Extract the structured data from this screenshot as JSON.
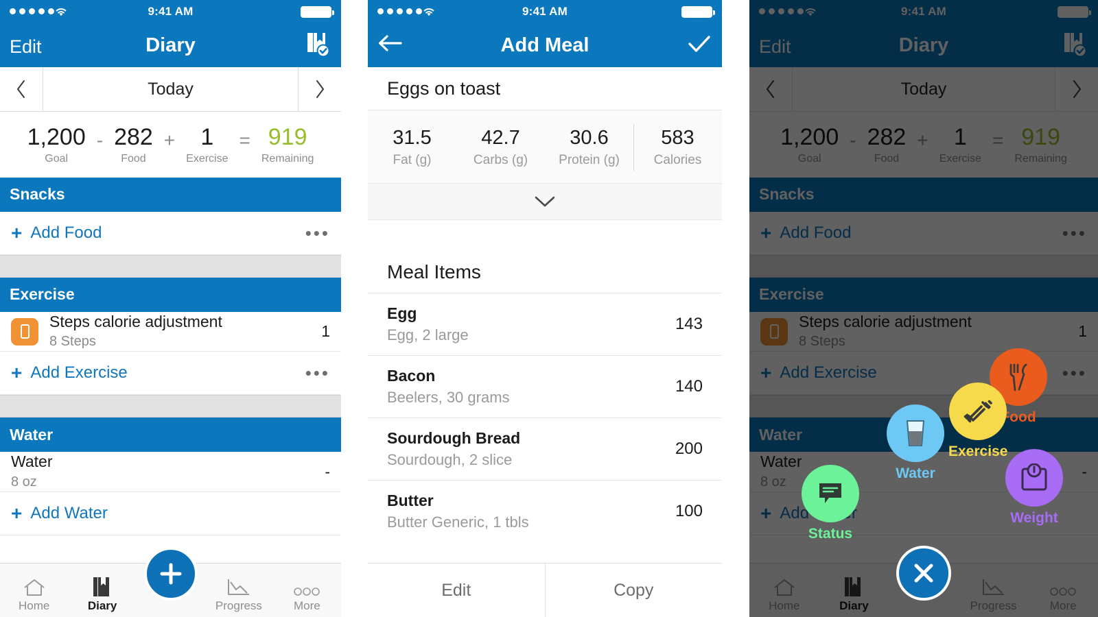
{
  "status_bar": {
    "time": "9:41 AM",
    "signal_dots": 5,
    "wifi_icon": "wifi-icon",
    "battery_icon": "battery-full-icon"
  },
  "colors": {
    "brand_blue": "#0b77bd",
    "accent_link": "#1177bd",
    "remaining_green": "#97bc2c",
    "steps_orange": "#f09234",
    "water_blue": "#6dc8f3",
    "food_orange": "#e95c1e",
    "exercise_yellow": "#f7d94c",
    "status_green": "#6cf39a",
    "weight_purple": "#a96cf5",
    "dim_overlay": "rgba(0,0,0,0.62)"
  },
  "diary": {
    "nav": {
      "left_label": "Edit",
      "title": "Diary",
      "right_icon": "diary-check-icon"
    },
    "date_bar": {
      "prev_icon": "chevron-left-icon",
      "label": "Today",
      "next_icon": "chevron-right-icon"
    },
    "summary": {
      "cells": [
        {
          "value": "1,200",
          "label": "Goal",
          "green": false
        },
        {
          "value": "282",
          "label": "Food",
          "green": false
        },
        {
          "value": "1",
          "label": "Exercise",
          "green": false
        },
        {
          "value": "919",
          "label": "Remaining",
          "green": true
        }
      ],
      "operators": [
        "-",
        "+",
        "="
      ]
    },
    "sections": [
      {
        "header": "Snacks",
        "rows": [],
        "add": {
          "plus": "+",
          "label": "Add Food",
          "more_icon": "ellipsis-icon",
          "more": "•••"
        }
      },
      {
        "header": "Exercise",
        "rows": [
          {
            "icon": "steps-phone-icon",
            "title": "Steps calorie adjustment",
            "subtitle": "8 Steps",
            "value": "1"
          }
        ],
        "add": {
          "plus": "+",
          "label": "Add Exercise",
          "more_icon": "ellipsis-icon",
          "more": "•••"
        }
      },
      {
        "header": "Water",
        "rows": [
          {
            "icon": "",
            "title": "Water",
            "subtitle": "8 oz",
            "value": "-"
          }
        ],
        "add": {
          "plus": "+",
          "label": "Add Water",
          "more_icon": "ellipsis-icon",
          "more": ""
        }
      }
    ],
    "tabs": [
      {
        "label": "Home",
        "icon": "home-icon",
        "active": false
      },
      {
        "label": "Diary",
        "icon": "book-bookmark-icon",
        "active": true
      },
      {
        "label": "",
        "icon": "",
        "active": false
      },
      {
        "label": "Progress",
        "icon": "chart-line-icon",
        "active": false
      },
      {
        "label": "More",
        "icon": "ellipsis-circles-icon",
        "active": false
      }
    ],
    "fab": {
      "icon": "plus-icon"
    },
    "fab_close": {
      "icon": "close-x-icon"
    }
  },
  "add_meal": {
    "nav": {
      "back_icon": "arrow-left-icon",
      "title": "Add Meal",
      "confirm_icon": "checkmark-icon"
    },
    "meal_name": "Eggs on toast",
    "macros": [
      {
        "value": "31.5",
        "label": "Fat (g)"
      },
      {
        "value": "42.7",
        "label": "Carbs (g)"
      },
      {
        "value": "30.6",
        "label": "Protein (g)"
      },
      {
        "value": "583",
        "label": "Calories"
      }
    ],
    "expand_icon": "chevron-down-icon",
    "meal_items_title": "Meal Items",
    "meal_items": [
      {
        "name": "Egg",
        "detail": "Egg, 2 large",
        "calories": "143"
      },
      {
        "name": "Bacon",
        "detail": "Beelers, 30 grams",
        "calories": "140"
      },
      {
        "name": "Sourdough Bread",
        "detail": "Sourdough, 2 slice",
        "calories": "200"
      },
      {
        "name": "Butter",
        "detail": "Butter Generic, 1 tbls",
        "calories": "100"
      }
    ],
    "actions": [
      {
        "label": "Edit"
      },
      {
        "label": "Copy"
      }
    ]
  },
  "fab_menu": {
    "items": [
      {
        "label": "Water",
        "icon": "water-glass-icon",
        "color": "#6dc8f3",
        "text_color": "#6dc8f3"
      },
      {
        "label": "Food",
        "icon": "fork-knife-icon",
        "color": "#e95c1e",
        "text_color": "#e95c1e"
      },
      {
        "label": "Exercise",
        "icon": "dumbbell-icon",
        "color": "#f7d94c",
        "text_color": "#f7d94c"
      },
      {
        "label": "Status",
        "icon": "speech-bubble-icon",
        "color": "#6cf39a",
        "text_color": "#6cf39a"
      },
      {
        "label": "Weight",
        "icon": "scale-icon",
        "color": "#a96cf5",
        "text_color": "#a96cf5"
      }
    ]
  }
}
